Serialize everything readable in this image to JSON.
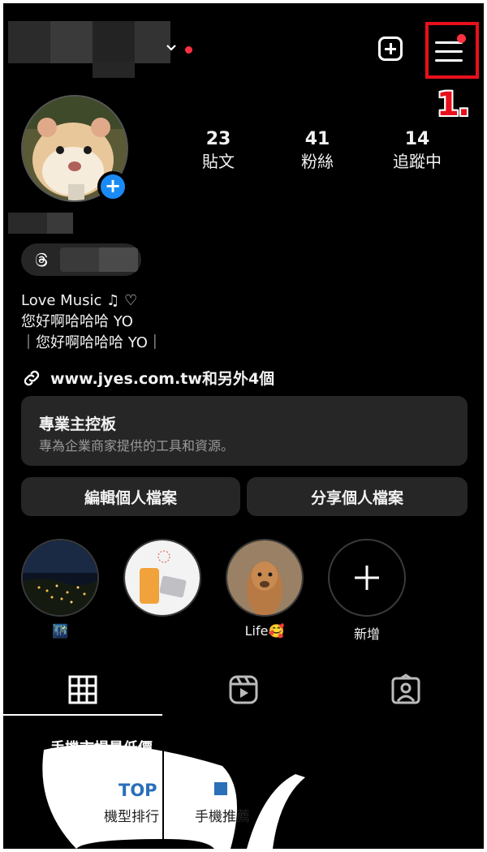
{
  "header": {
    "step_label": "1."
  },
  "stats": [
    {
      "value": "23",
      "label": "貼文"
    },
    {
      "value": "41",
      "label": "粉絲"
    },
    {
      "value": "14",
      "label": "追蹤中"
    }
  ],
  "bio": {
    "line1": "Love Music ♫ ♡",
    "line2": "您好啊哈哈哈 YO",
    "line3": "｜您好啊哈哈哈 YO｜"
  },
  "link": {
    "text": "www.jyes.com.tw和另外4個"
  },
  "dashboard": {
    "title": "專業主控板",
    "subtitle": "專為企業商家提供的工具和資源。"
  },
  "buttons": {
    "edit_profile": "編輯個人檔案",
    "share_profile": "分享個人檔案"
  },
  "highlights": [
    {
      "label": "🌃"
    },
    {
      "label": ""
    },
    {
      "label": "Life🥰"
    },
    {
      "label": "新增"
    }
  ],
  "grid_post": {
    "banner": "手機市場最低價",
    "top_badge": "TOP",
    "left_label": "機型排行",
    "right_label": "手機推薦"
  },
  "colors": {
    "background": "#000000",
    "accent_blue": "#1a8bf5",
    "notification_red": "#ff3040",
    "highlight_red": "#e8101b",
    "card": "#262626"
  }
}
